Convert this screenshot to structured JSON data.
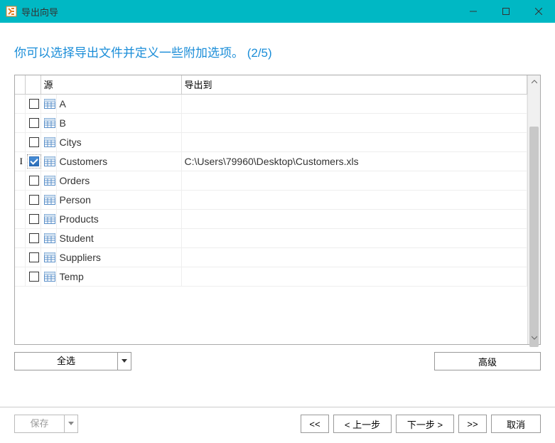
{
  "window": {
    "title": "导出向导"
  },
  "header": {
    "text": "你可以选择导出文件并定义一些附加选项。 (2/5)"
  },
  "table": {
    "columns": {
      "source": "源",
      "export_to": "导出到"
    },
    "rows": [
      {
        "checked": false,
        "marker": "",
        "name": "A",
        "export": ""
      },
      {
        "checked": false,
        "marker": "",
        "name": "B",
        "export": ""
      },
      {
        "checked": false,
        "marker": "",
        "name": "Citys",
        "export": ""
      },
      {
        "checked": true,
        "marker": "I",
        "name": "Customers",
        "export": "C:\\Users\\79960\\Desktop\\Customers.xls"
      },
      {
        "checked": false,
        "marker": "",
        "name": "Orders",
        "export": ""
      },
      {
        "checked": false,
        "marker": "",
        "name": "Person",
        "export": ""
      },
      {
        "checked": false,
        "marker": "",
        "name": "Products",
        "export": ""
      },
      {
        "checked": false,
        "marker": "",
        "name": "Student",
        "export": ""
      },
      {
        "checked": false,
        "marker": "",
        "name": "Suppliers",
        "export": ""
      },
      {
        "checked": false,
        "marker": "",
        "name": "Temp",
        "export": ""
      }
    ]
  },
  "buttons": {
    "select_all": "全选",
    "advanced": "高级",
    "save": "保存",
    "first": "<<",
    "prev": "< 上一步",
    "next": "下一步 >",
    "last": ">>",
    "cancel": "取消"
  }
}
